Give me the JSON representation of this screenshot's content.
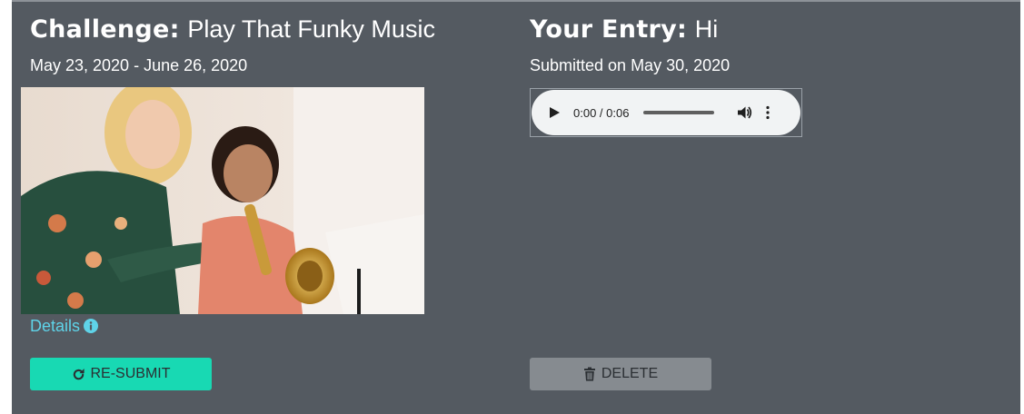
{
  "challenge": {
    "label": "Challenge:",
    "title": "Play That Funky Music",
    "dates": "May 23, 2020 - June 26, 2020",
    "details_link": "Details",
    "resubmit_button": "RE-SUBMIT"
  },
  "entry": {
    "label": "Your Entry:",
    "title": "Hi",
    "submitted": "Submitted on May 30, 2020",
    "audio_time": "0:00 / 0:06",
    "audio_progress": 0,
    "delete_button": "DELETE"
  },
  "colors": {
    "panel_bg": "#545a61",
    "accent_teal": "#18d9b3",
    "link_cyan": "#5fd3e8",
    "delete_gray": "#868b90"
  },
  "icons": {
    "info": "info-circle-icon",
    "redo": "redo-icon",
    "trash": "trash-icon",
    "play": "play-icon",
    "volume": "volume-icon",
    "more": "more-vertical-icon"
  }
}
